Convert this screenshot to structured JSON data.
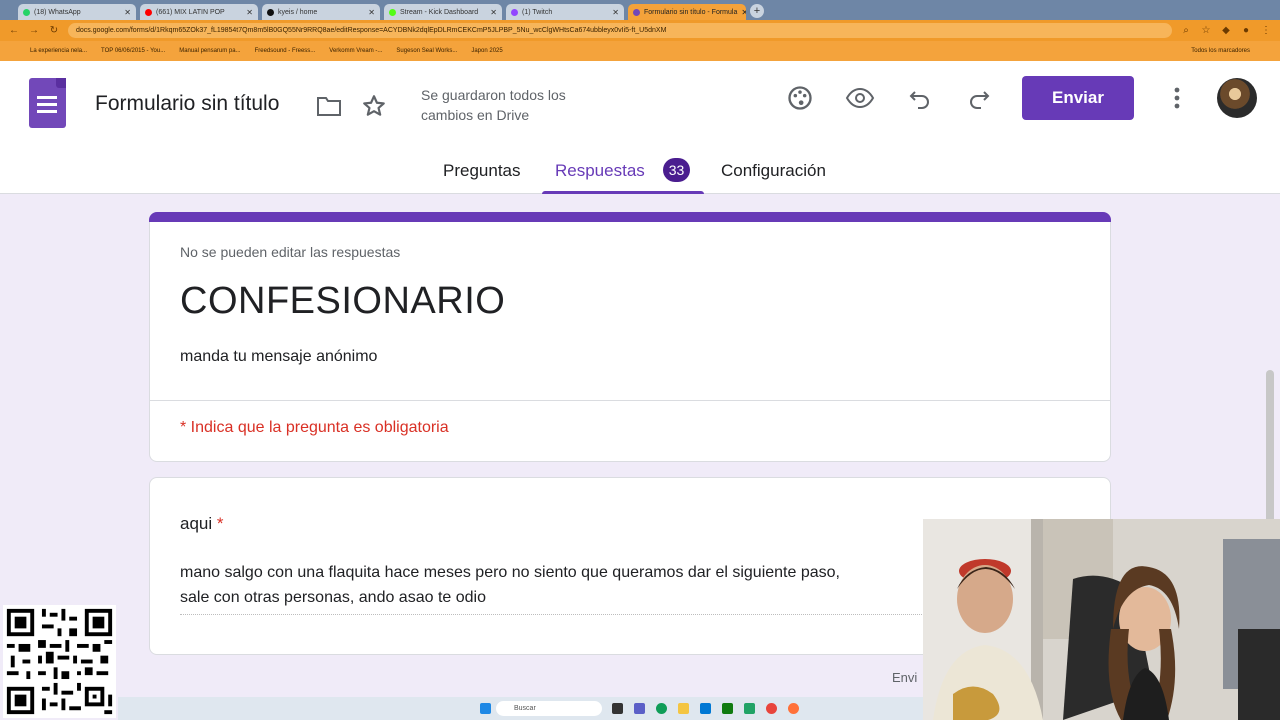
{
  "browser": {
    "tabs": [
      {
        "label": "(18) WhatsApp",
        "color": "#25d366"
      },
      {
        "label": "(661) MIX LATIN POP",
        "color": "#ff0000"
      },
      {
        "label": "kyeis / home",
        "color": "#111111"
      },
      {
        "label": "Stream - Kick Dashboard",
        "color": "#53fc18"
      },
      {
        "label": "(1) Twitch",
        "color": "#9146ff"
      },
      {
        "label": "Formulario sin título - Formula",
        "color": "#7248b9",
        "active": true
      }
    ],
    "url": "docs.google.com/forms/d/1Rkqm65ZOk37_fL19854t7Qm8m5lB0GQ55Nr9RRQ8ae/editResponse=ACYDBNk2dqlEpDLRmCEKCmP5JLPBP_5Nu_wcClgWHtsCa674ubbleyx0vIi5-ft_U5dnXM",
    "bookmarks": [
      "La experiencia nela...",
      "TOP 06/06/2015 - You...",
      "Manual pensarum pa...",
      "Freedsound - Freess...",
      "Verkomm Vream -...",
      "Sugeson Seal Works...",
      "Japon 2025"
    ],
    "bookmarks_right": "Todos los marcadores"
  },
  "header": {
    "title": "Formulario sin título",
    "save_status": "Se guardaron todos los cambios en Drive",
    "send_label": "Enviar"
  },
  "tabs": {
    "questions": "Preguntas",
    "responses": "Respuestas",
    "responses_count": "33",
    "settings": "Configuración"
  },
  "form": {
    "note": "No se pueden editar las respuestas",
    "title": "CONFESIONARIO",
    "description": "manda tu mensaje anónimo",
    "required_notice": "* Indica que la pregunta es obligatoria",
    "question": {
      "label": "aqui",
      "required_mark": "*",
      "answer_line1": "mano salgo con una flaquita hace meses pero no siento que queramos dar el siguiente paso,",
      "answer_line2": "sale con otras personas, ando asao te odio"
    },
    "footer_partial": "Envi"
  },
  "taskbar": {
    "search_placeholder": "Buscar"
  },
  "colors": {
    "accent": "#673ab7",
    "badge": "#4a1d8f",
    "required": "#d93025",
    "background": "#f0ebf8"
  }
}
